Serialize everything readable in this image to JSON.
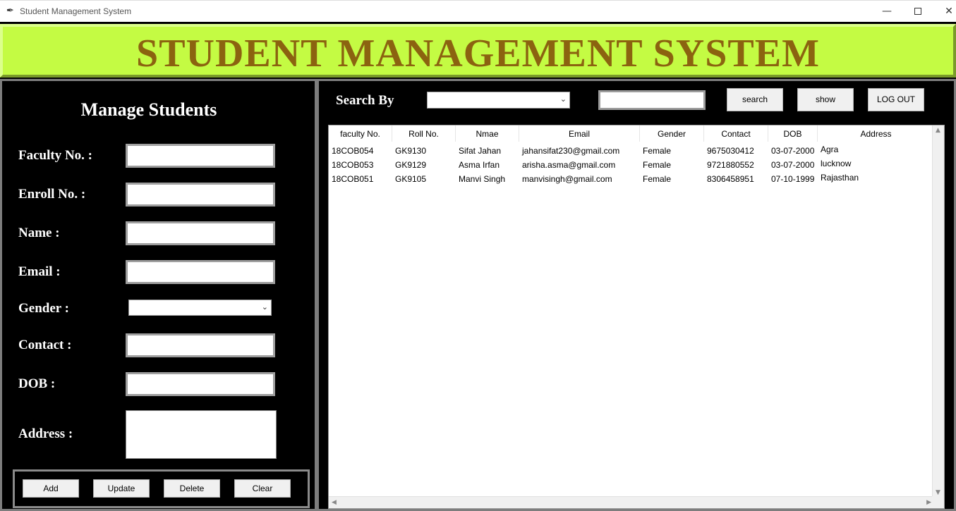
{
  "window": {
    "title": "Student Management System",
    "controls": {
      "minimize": "—",
      "close": "✕"
    }
  },
  "banner": {
    "title": "STUDENT MANAGEMENT SYSTEM"
  },
  "form": {
    "heading": "Manage Students",
    "labels": {
      "faculty": "Faculty No. :",
      "enroll": "Enroll No. :",
      "name": "Name :",
      "email": "Email :",
      "gender": "Gender :",
      "contact": "Contact :",
      "dob": "DOB :",
      "address": "Address :"
    },
    "values": {
      "faculty": "",
      "enroll": "",
      "name": "",
      "email": "",
      "gender": "",
      "contact": "",
      "dob": "",
      "address": ""
    },
    "buttons": {
      "add": "Add",
      "update": "Update",
      "delete": "Delete",
      "clear": "Clear"
    }
  },
  "search": {
    "label": "Search By",
    "by_value": "",
    "text_value": "",
    "buttons": {
      "search": "search",
      "show": "show",
      "logout": "LOG OUT"
    }
  },
  "table": {
    "columns": [
      "faculty No.",
      "Roll No.",
      "Nmae",
      "Email",
      "Gender",
      "Contact",
      "DOB",
      "Address"
    ],
    "rows": [
      [
        "18COB054",
        "GK9130",
        "Sifat Jahan",
        "jahansifat230@gmail.com",
        "Female",
        "9675030412",
        "03-07-2000",
        "Agra"
      ],
      [
        "18COB053",
        "GK9129",
        "Asma Irfan",
        "arisha.asma@gmail.com",
        "Female",
        "9721880552",
        "03-07-2000",
        "lucknow"
      ],
      [
        "18COB051",
        "GK9105",
        "Manvi Singh",
        "manvisingh@gmail.com",
        "Female",
        "8306458951",
        "07-10-1999",
        "Rajasthan"
      ]
    ]
  },
  "icons": {
    "app": "feather-icon",
    "dropdown": "chevron-down-icon"
  },
  "colors": {
    "banner_bg": "#c4fb43",
    "banner_text": "#8b6310",
    "panel_bg": "#000000"
  }
}
